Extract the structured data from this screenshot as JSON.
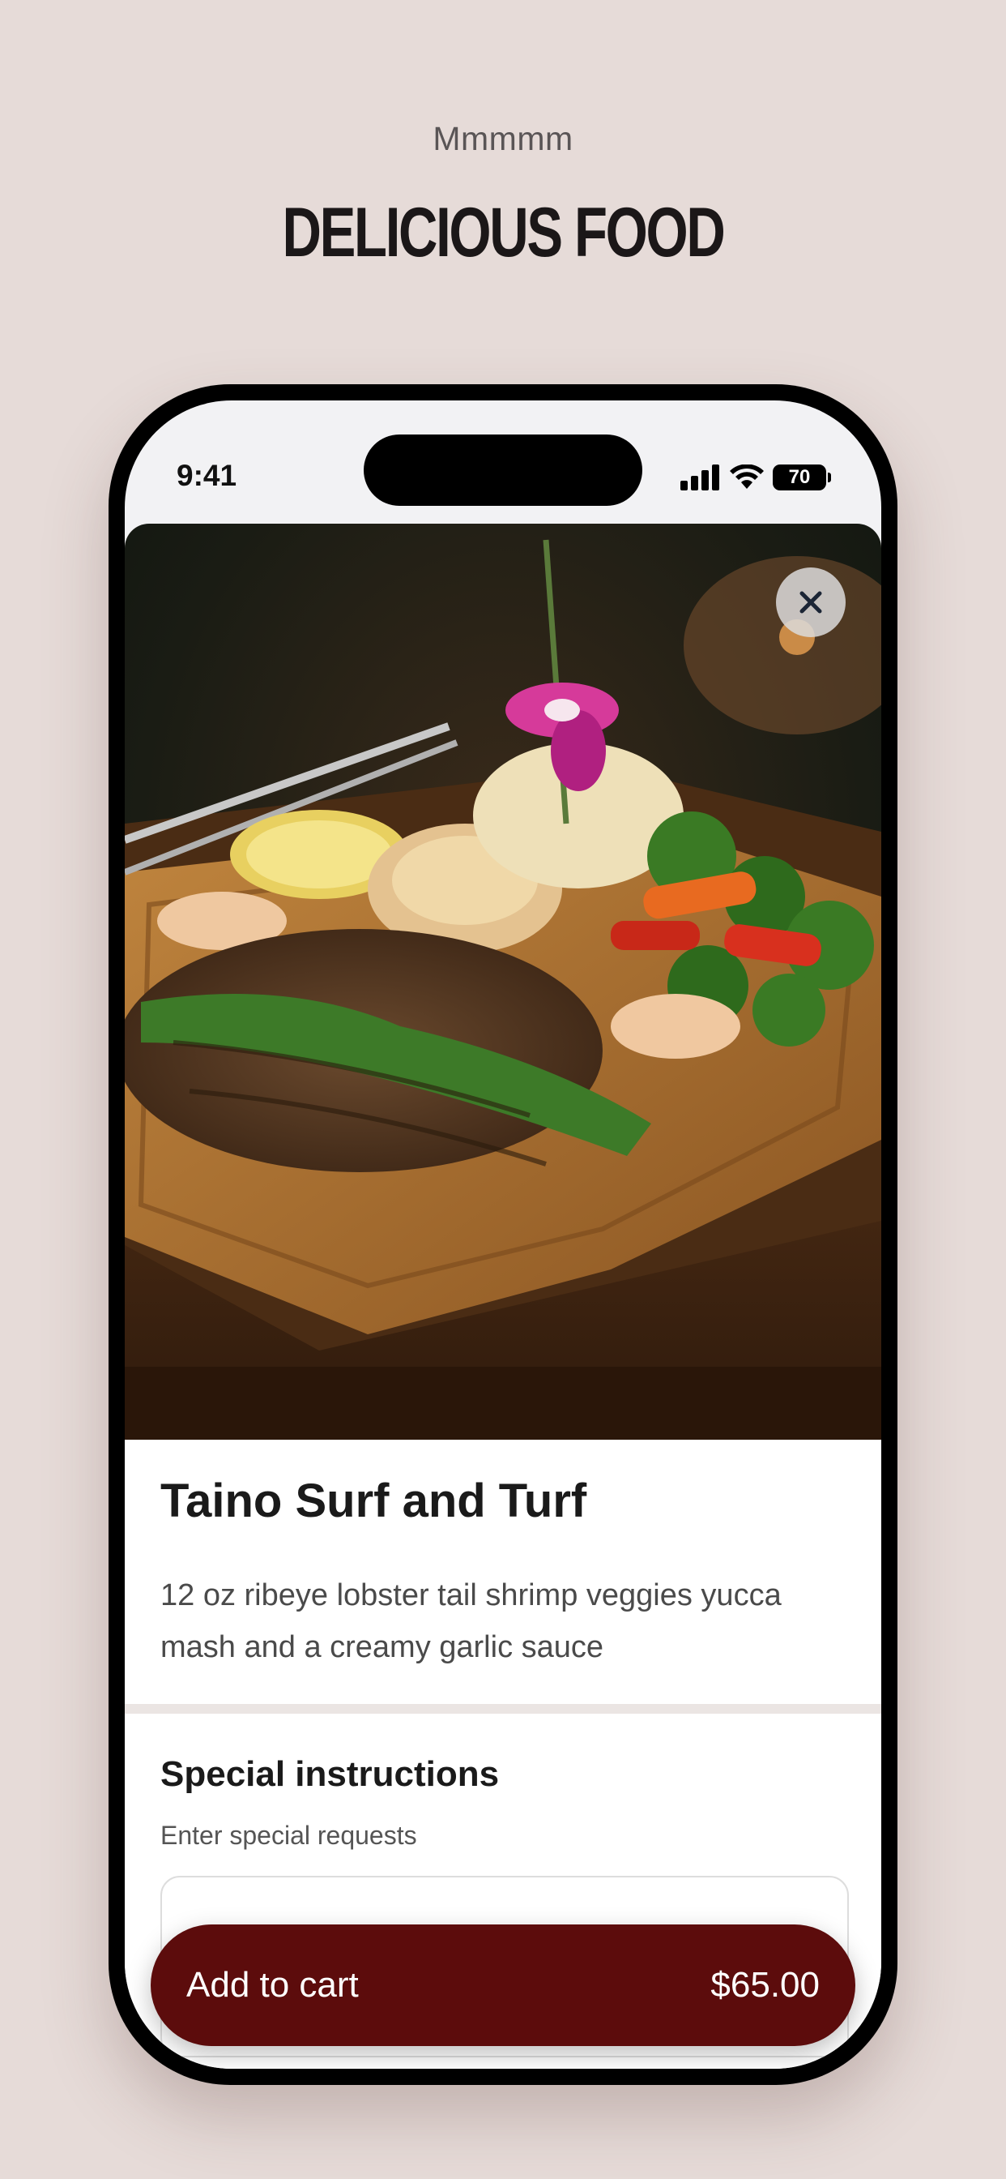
{
  "promo": {
    "eyebrow": "Mmmmm",
    "title": "DELICIOUS FOOD"
  },
  "status_bar": {
    "time": "9:41",
    "battery": "70"
  },
  "item": {
    "image_icon": "food-photo",
    "title": "Taino Surf and Turf",
    "description": "12 oz ribeye lobster tail shrimp veggies yucca mash and a creamy garlic sauce"
  },
  "special_instructions": {
    "title": "Special instructions",
    "subtitle": "Enter special requests",
    "value": ""
  },
  "cart": {
    "label": "Add to cart",
    "price": "$65.00"
  },
  "colors": {
    "background": "#e6dbd8",
    "cart_button": "#5c0c0c"
  }
}
